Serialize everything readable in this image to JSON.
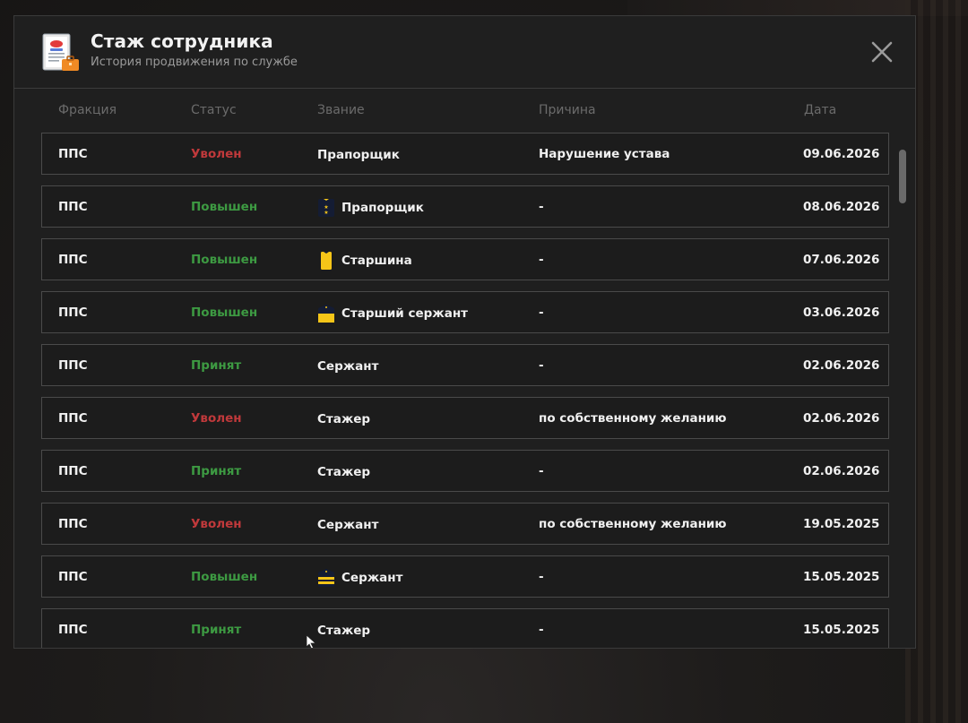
{
  "header": {
    "title": "Стаж сотрудника",
    "subtitle": "История продвижения по службе"
  },
  "columns": {
    "faction": "Фракция",
    "status": "Статус",
    "rank": "Звание",
    "reason": "Причина",
    "date": "Дата"
  },
  "colors": {
    "dismissed": "#c0393b",
    "promoted": "#3d9a42",
    "badge_navy": "#141c34",
    "badge_gold": "#f5c518"
  },
  "rows": [
    {
      "faction": "ППС",
      "status": "Уволен",
      "status_type": "red",
      "rank": "Прапорщик",
      "rank_badge": "",
      "reason": "Нарушение устава",
      "date": "09.06.2026"
    },
    {
      "faction": "ППС",
      "status": "Повышен",
      "status_type": "green",
      "rank": "Прапорщик",
      "rank_badge": "praporshchik-badge-icon",
      "reason": "-",
      "date": "08.06.2026"
    },
    {
      "faction": "ППС",
      "status": "Повышен",
      "status_type": "green",
      "rank": "Старшина",
      "rank_badge": "starshina-badge-icon",
      "reason": "-",
      "date": "07.06.2026"
    },
    {
      "faction": "ППС",
      "status": "Повышен",
      "status_type": "green",
      "rank": "Старший сержант",
      "rank_badge": "senior-sergeant-badge-icon",
      "reason": "-",
      "date": "03.06.2026"
    },
    {
      "faction": "ППС",
      "status": "Принят",
      "status_type": "green",
      "rank": "Сержант",
      "rank_badge": "",
      "reason": "-",
      "date": "02.06.2026"
    },
    {
      "faction": "ППС",
      "status": "Уволен",
      "status_type": "red",
      "rank": "Стажер",
      "rank_badge": "",
      "reason": "по собственному желанию",
      "date": "02.06.2026"
    },
    {
      "faction": "ППС",
      "status": "Принят",
      "status_type": "green",
      "rank": "Стажер",
      "rank_badge": "",
      "reason": "-",
      "date": "02.06.2026"
    },
    {
      "faction": "ППС",
      "status": "Уволен",
      "status_type": "red",
      "rank": "Сержант",
      "rank_badge": "",
      "reason": "по собственному желанию",
      "date": "19.05.2025"
    },
    {
      "faction": "ППС",
      "status": "Повышен",
      "status_type": "green",
      "rank": "Сержант",
      "rank_badge": "sergeant-badge-icon",
      "reason": "-",
      "date": "15.05.2025"
    },
    {
      "faction": "ППС",
      "status": "Принят",
      "status_type": "green",
      "rank": "Стажер",
      "rank_badge": "",
      "reason": "-",
      "date": "15.05.2025"
    }
  ]
}
